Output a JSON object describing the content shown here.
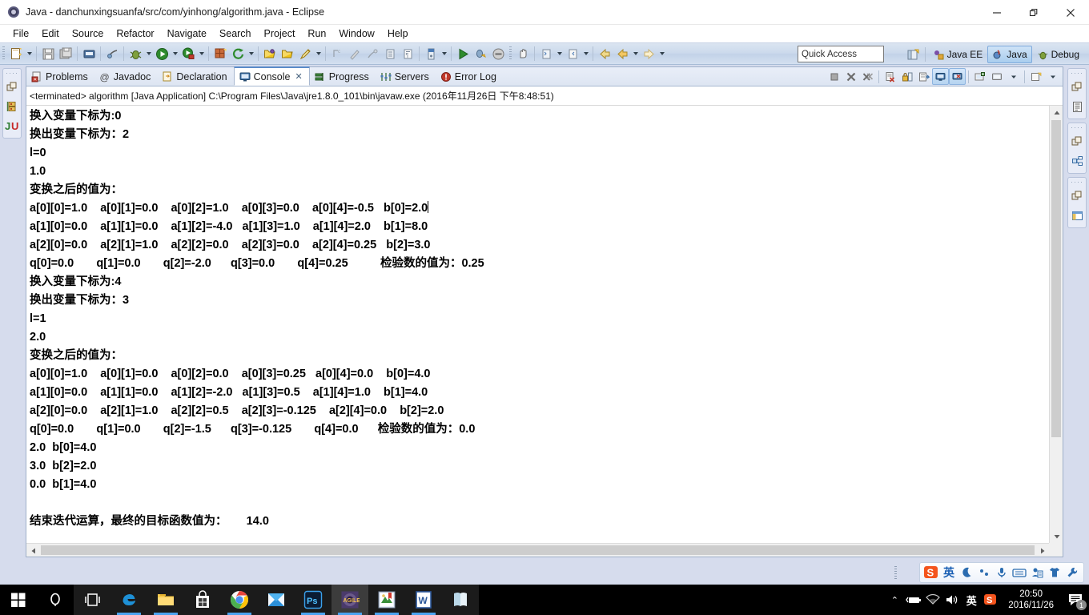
{
  "window": {
    "title": "Java - danchunxingsuanfa/src/com/yinhong/algorithm.java - Eclipse",
    "minimize": "–",
    "restore": "❐",
    "close": "✕"
  },
  "menubar": {
    "items": [
      "File",
      "Edit",
      "Source",
      "Refactor",
      "Navigate",
      "Search",
      "Project",
      "Run",
      "Window",
      "Help"
    ]
  },
  "toolbar": {
    "quick_access": "Quick Access",
    "perspectives": [
      {
        "label": "Java EE",
        "active": false
      },
      {
        "label": "Java",
        "active": true
      },
      {
        "label": "Debug",
        "active": false
      }
    ]
  },
  "left_fastview": {
    "icons": [
      "restore-icon",
      "package-explorer-icon",
      "junit-icon"
    ]
  },
  "right_fastview": {
    "groups": [
      [
        "restore-icon",
        "document-outline-icon"
      ],
      [
        "restore-icon",
        "hierarchy-icon"
      ],
      [
        "restore-icon",
        "layout-icon"
      ]
    ]
  },
  "view_tabs": [
    {
      "label": "Problems",
      "icon": "problems-icon",
      "active": false
    },
    {
      "label": "Javadoc",
      "icon": "javadoc-icon",
      "active": false
    },
    {
      "label": "Declaration",
      "icon": "declaration-icon",
      "active": false
    },
    {
      "label": "Console",
      "icon": "console-icon",
      "active": true,
      "close": "✕"
    },
    {
      "label": "Progress",
      "icon": "progress-icon",
      "active": false
    },
    {
      "label": "Servers",
      "icon": "servers-icon",
      "active": false
    },
    {
      "label": "Error Log",
      "icon": "error-log-icon",
      "active": false
    }
  ],
  "console_toolbar": [
    "terminate-icon",
    "remove-launch-icon",
    "remove-all-launches-icon",
    "clear-console-icon",
    "scroll-lock-icon",
    "pin-console-icon",
    "display-selected-console-icon",
    "open-console-icon",
    "new-console-view-icon",
    "console-menu-icon",
    "minimize-icon"
  ],
  "console": {
    "status": "<terminated> algorithm [Java Application] C:\\Program Files\\Java\\jre1.8.0_101\\bin\\javaw.exe (2016年11月26日 下午8:48:51)",
    "lines": [
      "换入变量下标为:0",
      "换出变量下标为：2",
      "l=0",
      "1.0",
      "变换之后的值为：",
      "a[0][0]=1.0    a[0][1]=0.0    a[0][2]=1.0    a[0][3]=0.0    a[0][4]=-0.5   b[0]=2.0",
      "a[1][0]=0.0    a[1][1]=0.0    a[1][2]=-4.0   a[1][3]=1.0    a[1][4]=2.0    b[1]=8.0",
      "a[2][0]=0.0    a[2][1]=1.0    a[2][2]=0.0    a[2][3]=0.0    a[2][4]=0.25   b[2]=3.0",
      "q[0]=0.0       q[1]=0.0       q[2]=-2.0      q[3]=0.0       q[4]=0.25          检验数的值为：0.25",
      "换入变量下标为:4",
      "换出变量下标为：3",
      "l=1",
      "2.0",
      "变换之后的值为：",
      "a[0][0]=1.0    a[0][1]=0.0    a[0][2]=0.0    a[0][3]=0.25   a[0][4]=0.0    b[0]=4.0",
      "a[1][0]=0.0    a[1][1]=0.0    a[1][2]=-2.0   a[1][3]=0.5    a[1][4]=1.0    b[1]=4.0",
      "a[2][0]=0.0    a[2][1]=1.0    a[2][2]=0.5    a[2][3]=-0.125    a[2][4]=0.0    b[2]=2.0",
      "q[0]=0.0       q[1]=0.0       q[2]=-1.5      q[3]=-0.125       q[4]=0.0      检验数的值为：0.0",
      "2.0  b[0]=4.0",
      "3.0  b[2]=2.0",
      "0.0  b[1]=4.0",
      "",
      "结束迭代运算，最终的目标函数值为：      14.0"
    ],
    "caret_line": 5
  },
  "ime": {
    "icons": [
      "sogou-logo-icon",
      "chinese-mode-icon",
      "moon-icon",
      "punctuation-icon",
      "microphone-icon",
      "keyboard-icon",
      "clipboard-icon",
      "skin-icon",
      "tools-icon"
    ],
    "mode_label": "英"
  },
  "taskbar": {
    "start": "start-icon",
    "search": "cortana-search-icon",
    "taskview": "task-view-icon",
    "apps": [
      {
        "name": "edge-icon",
        "running": true
      },
      {
        "name": "file-explorer-icon",
        "running": true
      },
      {
        "name": "microsoft-store-icon",
        "running": false
      },
      {
        "name": "chrome-icon",
        "running": true
      },
      {
        "name": "foxmail-icon",
        "running": false
      },
      {
        "name": "photoshop-icon",
        "running": true
      },
      {
        "name": "eclipse-icon",
        "running": true,
        "active": true
      },
      {
        "name": "notes-icon",
        "running": true
      },
      {
        "name": "word-icon",
        "running": true
      },
      {
        "name": "reader-icon",
        "running": false
      }
    ],
    "tray": {
      "chevron": "⌃",
      "icons": [
        "battery-icon",
        "wifi-icon",
        "volume-icon"
      ],
      "ime_label": "英",
      "sogou": "sogou-tray-icon",
      "time": "20:50",
      "date": "2016/11/26",
      "notifications": "1"
    }
  }
}
